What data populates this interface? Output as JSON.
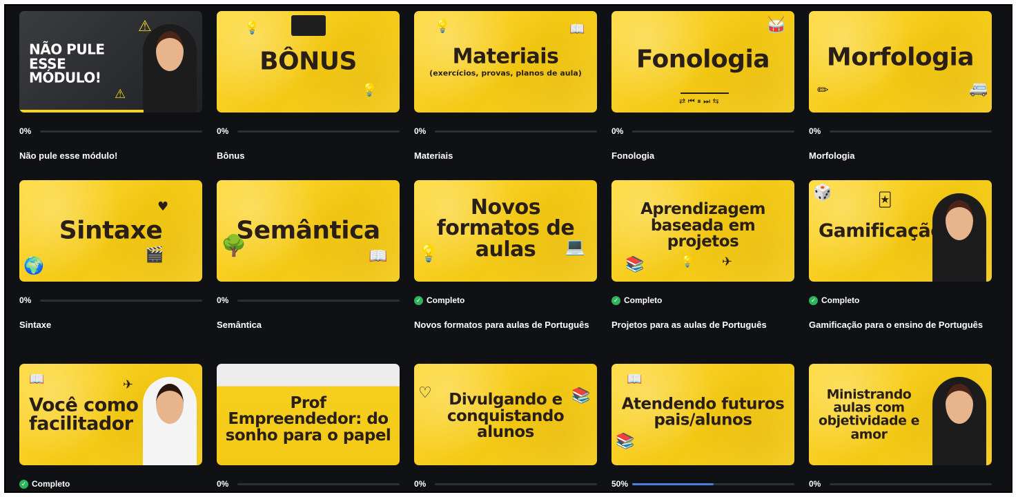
{
  "modules": [
    {
      "name": "Não pule esse módulo!",
      "thumb_title": "NÃO PULE ESSE MÓDULO!",
      "thumb_sub": "",
      "status": "progress",
      "percent": "0%",
      "progress": 0
    },
    {
      "name": "Bônus",
      "thumb_title": "BÔNUS",
      "thumb_sub": "",
      "status": "progress",
      "percent": "0%",
      "progress": 0
    },
    {
      "name": "Materiais",
      "thumb_title": "Materiais",
      "thumb_sub": "(exercícios, provas, planos de aula)",
      "status": "progress",
      "percent": "0%",
      "progress": 0
    },
    {
      "name": "Fonologia",
      "thumb_title": "Fonologia",
      "thumb_sub": "",
      "status": "progress",
      "percent": "0%",
      "progress": 0
    },
    {
      "name": "Morfologia",
      "thumb_title": "Morfologia",
      "thumb_sub": "",
      "status": "progress",
      "percent": "0%",
      "progress": 0
    },
    {
      "name": "Sintaxe",
      "thumb_title": "Sintaxe",
      "thumb_sub": "",
      "status": "progress",
      "percent": "0%",
      "progress": 0
    },
    {
      "name": "Semântica",
      "thumb_title": "Semântica",
      "thumb_sub": "",
      "status": "progress",
      "percent": "0%",
      "progress": 0
    },
    {
      "name": "Novos formatos para aulas de Português",
      "thumb_title": "Novos formatos de aulas",
      "thumb_sub": "",
      "status": "complete",
      "complete_label": "Completo"
    },
    {
      "name": "Projetos para as aulas de Português",
      "thumb_title": "Aprendizagem baseada em projetos",
      "thumb_sub": "",
      "status": "complete",
      "complete_label": "Completo"
    },
    {
      "name": "Gamificação para o ensino de Português",
      "thumb_title": "Gamificação",
      "thumb_sub": "",
      "status": "complete",
      "complete_label": "Completo"
    },
    {
      "name": "",
      "thumb_title": "Você como facilitador",
      "thumb_sub": "",
      "status": "complete",
      "complete_label": "Completo"
    },
    {
      "name": "",
      "thumb_title": "Prof Empreendedor: do sonho para o papel",
      "thumb_sub": "",
      "status": "progress",
      "percent": "0%",
      "progress": 0
    },
    {
      "name": "",
      "thumb_title": "Divulgando e conquistando alunos",
      "thumb_sub": "",
      "status": "progress",
      "percent": "0%",
      "progress": 0
    },
    {
      "name": "",
      "thumb_title": "Atendendo futuros pais/alunos",
      "thumb_sub": "",
      "status": "progress",
      "percent": "50%",
      "progress": 0.5
    },
    {
      "name": "",
      "thumb_title": "Ministrando aulas com objetividade e amor",
      "thumb_sub": "",
      "status": "progress",
      "percent": "0%",
      "progress": 0
    }
  ],
  "icons": {
    "complete": "check-circle-icon"
  },
  "colors": {
    "background": "#0f1114",
    "thumb_yellow": "#f6cf1f",
    "progress_blue": "#4a7fe0",
    "complete_green": "#2fb45e"
  }
}
